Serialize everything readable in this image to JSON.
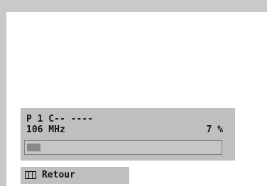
{
  "osd": {
    "channel_line": "P 1 C-- ----",
    "frequency": "106 MHz",
    "percent_text": "7 %",
    "progress": 0.07
  },
  "footer": {
    "icon": "menu-icon",
    "label": "Retour"
  },
  "colors": {
    "frame": "#c9c9c9",
    "screen": "#ffffff",
    "panel": "#bfbfbf",
    "bar_fill": "#888888"
  }
}
